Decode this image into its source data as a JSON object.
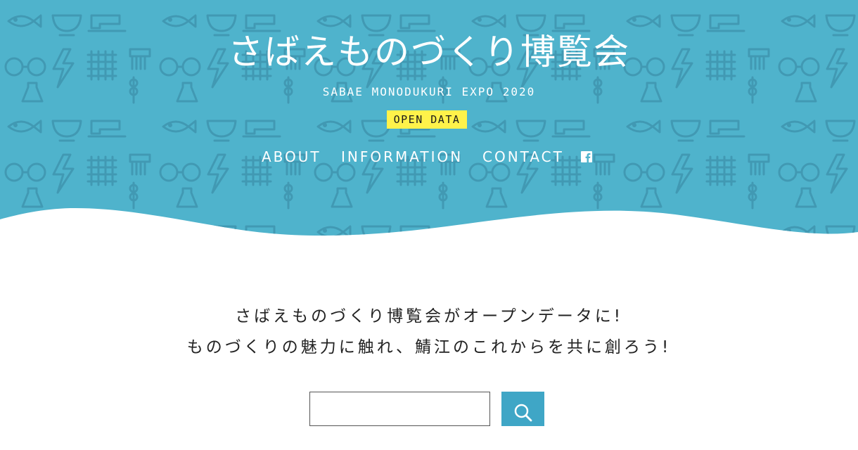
{
  "site": {
    "title": "さばえものづくり博覧会",
    "subtitle": "SABAE MONODUKURI EXPO 2020",
    "badge": "OPEN DATA"
  },
  "nav": {
    "items": [
      {
        "label": "ABOUT"
      },
      {
        "label": "INFORMATION"
      },
      {
        "label": "CONTACT"
      }
    ],
    "social_icon": "facebook-icon"
  },
  "intro": {
    "line1": "さばえものづくり博覧会がオープンデータに!",
    "line2": "ものづくりの魅力に触れ、鯖江のこれからを共に創ろう!"
  },
  "search": {
    "value": "",
    "placeholder": "",
    "button_icon": "search-icon"
  },
  "colors": {
    "hero_background": "#4fb3cc",
    "hero_pattern": "#3f96b0",
    "badge_background": "#fff24a",
    "search_button": "#3fa6c6",
    "text": "#222222"
  }
}
